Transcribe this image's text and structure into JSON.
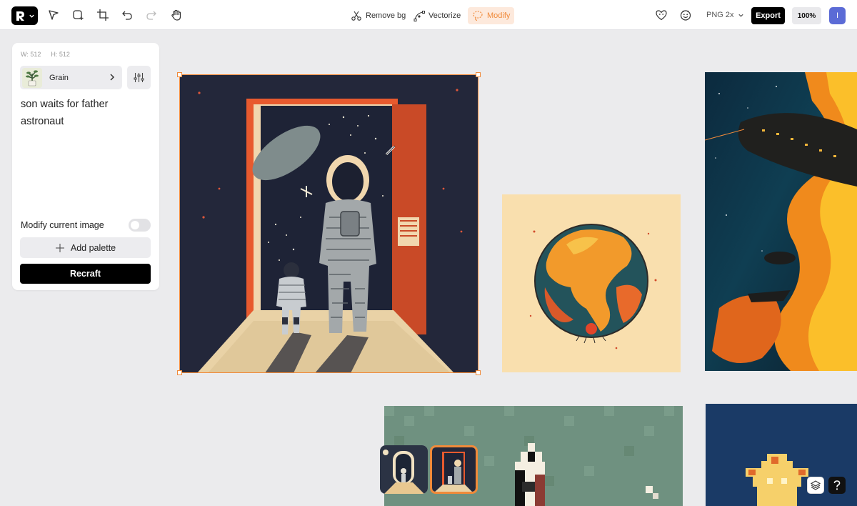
{
  "toolbar": {
    "actions": [
      {
        "label": "Remove bg",
        "icon": "scissors-icon"
      },
      {
        "label": "Vectorize",
        "icon": "vectorize-icon"
      },
      {
        "label": "Modify",
        "icon": "lasso-icon",
        "active": true
      }
    ],
    "format_label": "PNG 2x",
    "export_label": "Export",
    "zoom_label": "100%",
    "avatar_letter": "I"
  },
  "panel": {
    "width_label": "W: 512",
    "height_label": "H: 512",
    "style_name": "Grain",
    "prompt": "son waits for father astronaut",
    "modify_label": "Modify current image",
    "modify_enabled": false,
    "add_palette_label": "Add palette",
    "recraft_label": "Recraft"
  },
  "colors": {
    "accent": "#f08a3a",
    "accent_bg": "#fde9dc",
    "canvas_bg": "#ebebed",
    "avatar": "#5b6bd6"
  },
  "canvas": {
    "images": [
      {
        "name": "astronaut-son-image",
        "selected": true
      },
      {
        "name": "earth-globe-image"
      },
      {
        "name": "spaceship-nebula-image"
      },
      {
        "name": "pixel-rocket-image"
      },
      {
        "name": "pixel-star-image"
      }
    ],
    "thumbnails": [
      {
        "name": "variant-thumb-1",
        "selected": false
      },
      {
        "name": "variant-thumb-2",
        "selected": true
      }
    ]
  }
}
